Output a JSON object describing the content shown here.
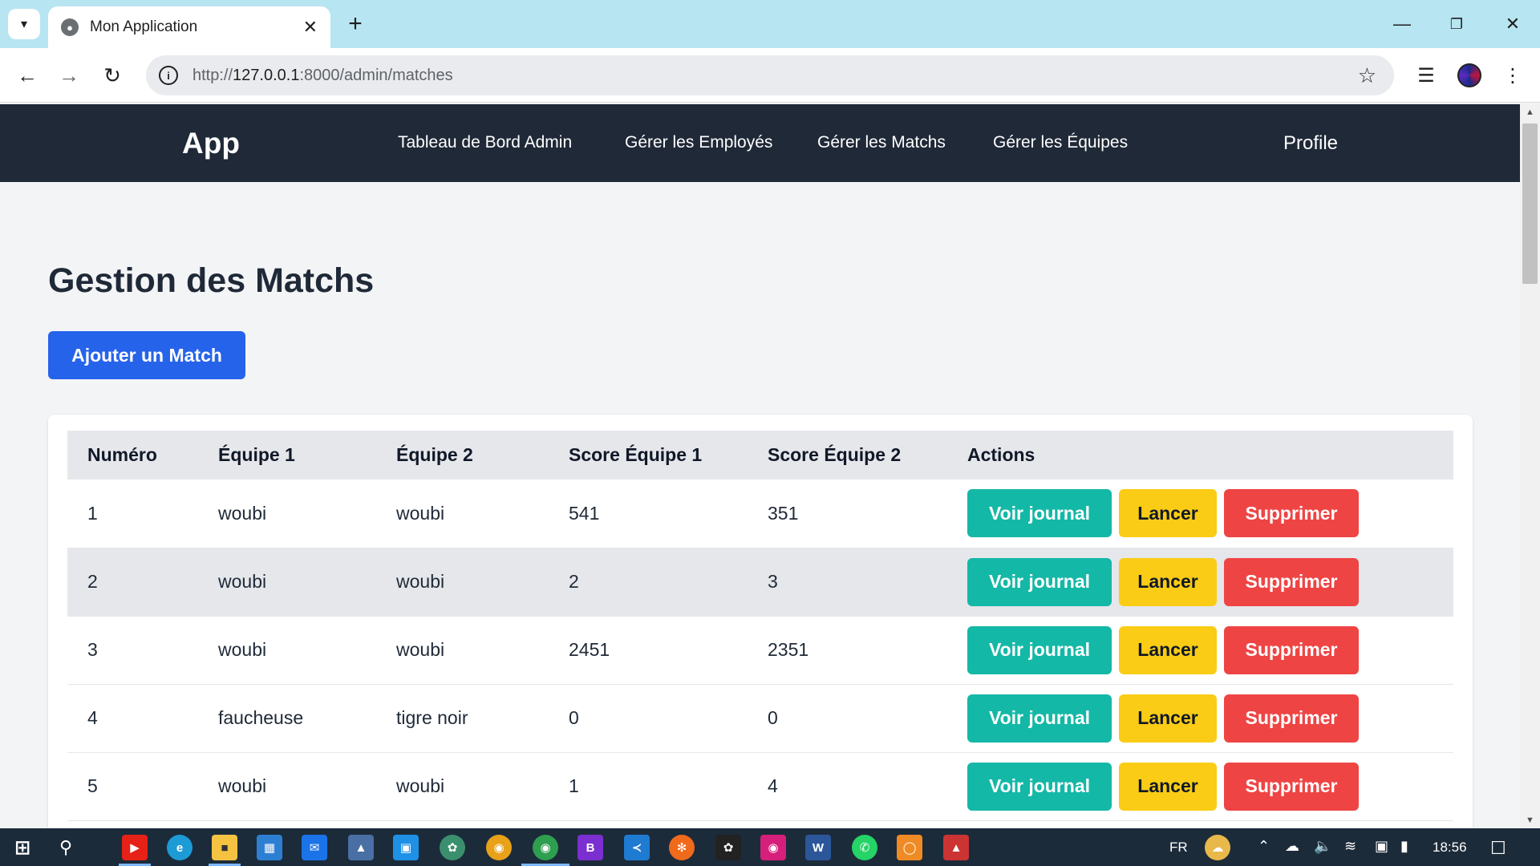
{
  "browser": {
    "tab_title": "Mon Application",
    "url_prefix": "http://",
    "url_host": "127.0.0.1",
    "url_path": ":8000/admin/matches"
  },
  "navbar": {
    "brand": "App",
    "links": [
      "Tableau de Bord Admin",
      "Gérer les Employés",
      "Gérer les Matchs",
      "Gérer les Équipes"
    ],
    "profile": "Profile"
  },
  "main": {
    "title": "Gestion des Matchs",
    "add_button": "Ajouter un Match"
  },
  "table": {
    "headers": [
      "Numéro",
      "Équipe 1",
      "Équipe 2",
      "Score Équipe 1",
      "Score Équipe 2",
      "Actions"
    ],
    "rows": [
      {
        "num": "1",
        "team1": "woubi",
        "team2": "woubi",
        "score1": "541",
        "score2": "351"
      },
      {
        "num": "2",
        "team1": "woubi",
        "team2": "woubi",
        "score1": "2",
        "score2": "3"
      },
      {
        "num": "3",
        "team1": "woubi",
        "team2": "woubi",
        "score1": "2451",
        "score2": "2351"
      },
      {
        "num": "4",
        "team1": "faucheuse",
        "team2": "tigre noir",
        "score1": "0",
        "score2": "0"
      },
      {
        "num": "5",
        "team1": "woubi",
        "team2": "woubi",
        "score1": "1",
        "score2": "4"
      }
    ],
    "actions": {
      "view": "Voir journal",
      "launch": "Lancer",
      "delete": "Supprimer"
    }
  },
  "taskbar": {
    "language": "FR",
    "time": "18:56"
  },
  "colors": {
    "navbar_bg": "#1f2937",
    "primary": "#2563eb",
    "teal": "#14b8a6",
    "yellow": "#facc15",
    "red": "#ef4444"
  }
}
